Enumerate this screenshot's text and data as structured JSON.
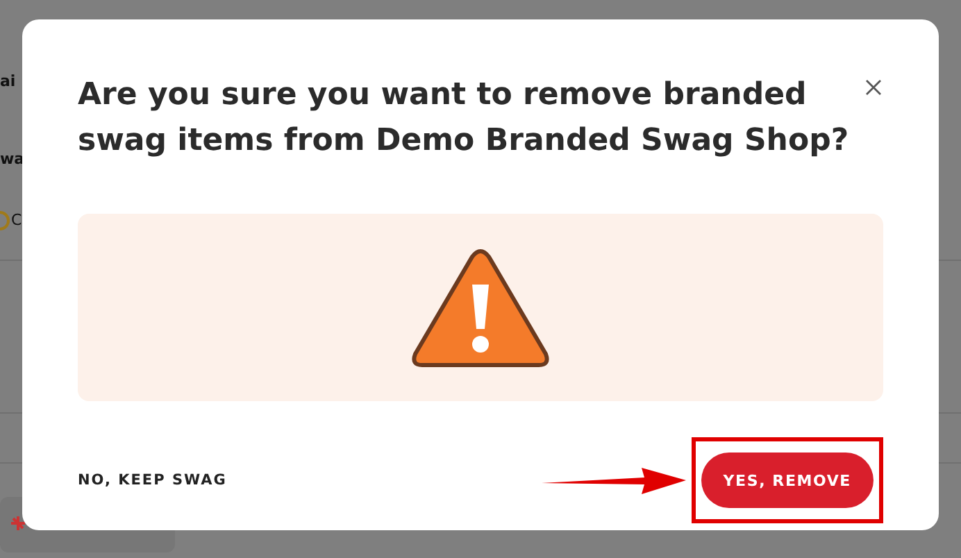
{
  "background": {
    "texts": [
      "ai",
      "wa",
      "C"
    ]
  },
  "dialog": {
    "title": "Are you sure you want to remove branded swag items from Demo Branded Swag Shop?",
    "cancel_button": "NO, KEEP SWAG",
    "confirm_button": "YES, REMOVE"
  }
}
